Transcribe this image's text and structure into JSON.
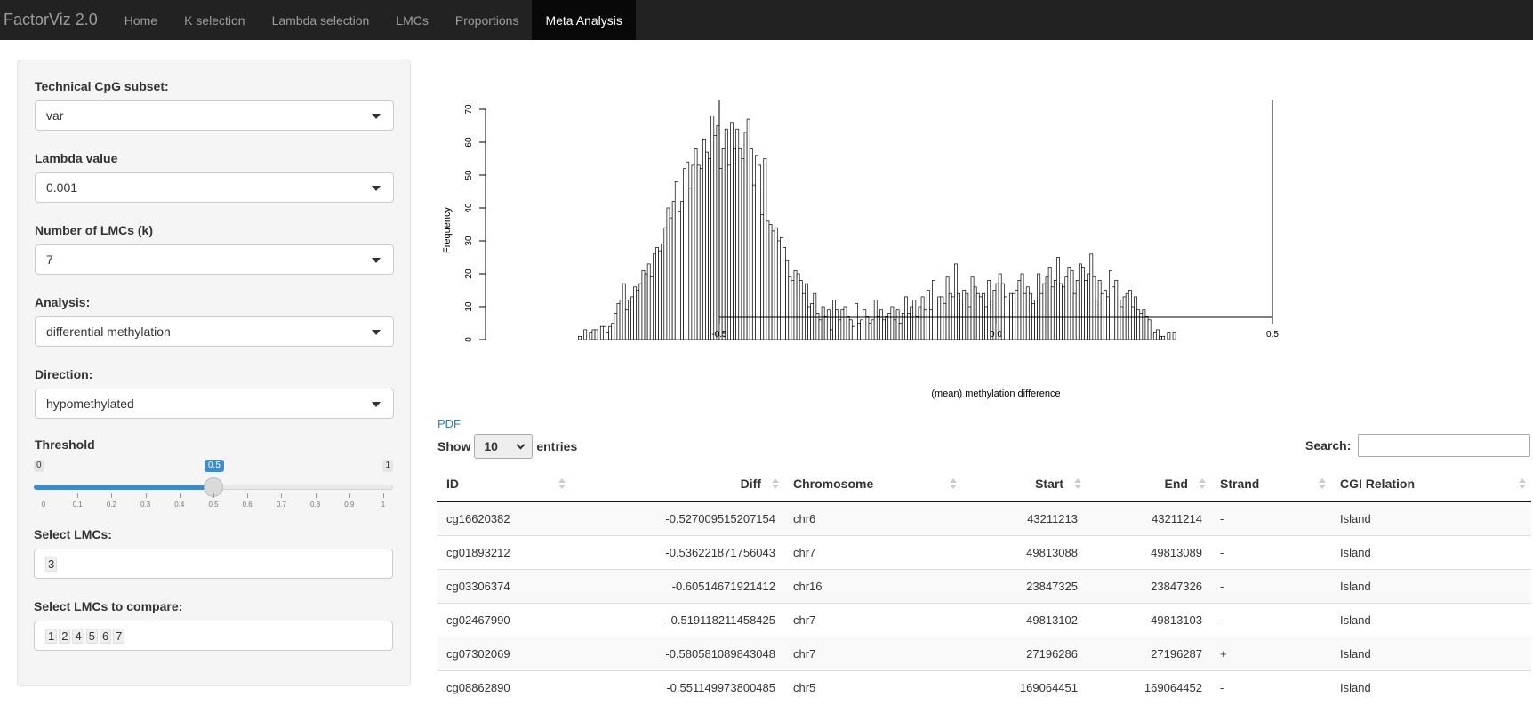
{
  "navbar": {
    "brand": "FactorViz 2.0",
    "tabs": [
      "Home",
      "K selection",
      "Lambda selection",
      "LMCs",
      "Proportions",
      "Meta Analysis"
    ],
    "active_tab": "Meta Analysis"
  },
  "sidebar": {
    "cpg_subset": {
      "label": "Technical CpG subset:",
      "value": "var"
    },
    "lambda": {
      "label": "Lambda value",
      "value": "0.001"
    },
    "k": {
      "label": "Number of LMCs (k)",
      "value": "7"
    },
    "analysis": {
      "label": "Analysis:",
      "value": "differential methylation"
    },
    "direction": {
      "label": "Direction:",
      "value": "hypomethylated"
    },
    "threshold": {
      "label": "Threshold",
      "min": "0",
      "max": "1",
      "value": "0.5",
      "fraction": 0.5,
      "ticks": [
        "0",
        "0.1",
        "0.2",
        "0.3",
        "0.4",
        "0.5",
        "0.6",
        "0.7",
        "0.8",
        "0.9",
        "1"
      ]
    },
    "select_lmcs": {
      "label": "Select LMCs:",
      "value": "3"
    },
    "compare_lmcs": {
      "label": "Select LMCs to compare:",
      "values": [
        "1",
        "2",
        "4",
        "5",
        "6",
        "7"
      ]
    }
  },
  "chart_data": {
    "type": "bar",
    "subtype": "histogram",
    "xlabel": "(mean) methylation difference",
    "ylabel": "Frequency",
    "xlim": [
      -0.78,
      0.58
    ],
    "ylim": [
      0,
      70
    ],
    "xticks": [
      "-0.5",
      "0.0",
      "0.5"
    ],
    "yticks": [
      "0",
      "10",
      "20",
      "30",
      "40",
      "50",
      "60",
      "70"
    ],
    "vlines": [
      -0.5,
      0.5
    ],
    "bin_width": 0.005,
    "x_start": -0.755,
    "values": [
      1,
      0,
      3,
      0,
      2,
      3,
      3,
      0,
      4,
      4,
      2,
      4,
      5,
      8,
      11,
      12,
      17,
      9,
      12,
      13,
      16,
      15,
      17,
      21,
      20,
      23,
      19,
      26,
      28,
      27,
      29,
      34,
      40,
      37,
      42,
      48,
      39,
      42,
      52,
      54,
      46,
      53,
      58,
      53,
      52,
      61,
      57,
      55,
      68,
      62,
      65,
      52,
      58,
      64,
      53,
      66,
      58,
      64,
      58,
      55,
      63,
      67,
      58,
      47,
      56,
      53,
      38,
      55,
      36,
      35,
      33,
      34,
      30,
      31,
      28,
      24,
      19,
      18,
      21,
      20,
      18,
      14,
      17,
      10,
      11,
      14,
      8,
      6,
      10,
      7,
      9,
      3,
      12,
      9,
      6,
      9,
      10,
      7,
      6,
      4,
      11,
      5,
      6,
      9,
      7,
      5,
      6,
      12,
      7,
      9,
      6,
      7,
      8,
      10,
      6,
      9,
      5,
      8,
      13,
      8,
      10,
      12,
      7,
      10,
      13,
      9,
      15,
      9,
      18,
      12,
      13,
      13,
      11,
      19,
      14,
      13,
      23,
      14,
      12,
      15,
      14,
      10,
      19,
      16,
      14,
      13,
      14,
      10,
      18,
      12,
      15,
      17,
      20,
      17,
      13,
      12,
      14,
      14,
      15,
      18,
      20,
      14,
      16,
      14,
      11,
      12,
      20,
      14,
      17,
      19,
      22,
      16,
      18,
      25,
      17,
      16,
      19,
      22,
      21,
      14,
      18,
      23,
      22,
      18,
      20,
      26,
      19,
      12,
      18,
      14,
      15,
      13,
      21,
      16,
      18,
      12,
      10,
      13,
      14,
      15,
      10,
      13,
      9,
      8,
      9,
      7,
      6,
      0,
      2,
      3,
      1,
      1,
      0,
      2,
      0,
      2
    ]
  },
  "pdf_link": "PDF",
  "table_controls": {
    "show_label": "Show",
    "entries_value": "10",
    "entries_label": "entries",
    "search_label": "Search:",
    "search_value": ""
  },
  "table": {
    "columns": [
      "ID",
      "Diff",
      "Chromosome",
      "Start",
      "End",
      "Strand",
      "CGI Relation"
    ],
    "rows": [
      [
        "cg16620382",
        "-0.527009515207154",
        "chr6",
        "43211213",
        "43211214",
        "-",
        "Island"
      ],
      [
        "cg01893212",
        "-0.536221871756043",
        "chr7",
        "49813088",
        "49813089",
        "-",
        "Island"
      ],
      [
        "cg03306374",
        "-0.60514671921412",
        "chr16",
        "23847325",
        "23847326",
        "-",
        "Island"
      ],
      [
        "cg02467990",
        "-0.519118211458425",
        "chr7",
        "49813102",
        "49813103",
        "-",
        "Island"
      ],
      [
        "cg07302069",
        "-0.580581089843048",
        "chr7",
        "27196286",
        "27196287",
        "+",
        "Island"
      ],
      [
        "cg08862890",
        "-0.551149973800485",
        "chr5",
        "169064451",
        "169064452",
        "-",
        "Island"
      ]
    ]
  }
}
